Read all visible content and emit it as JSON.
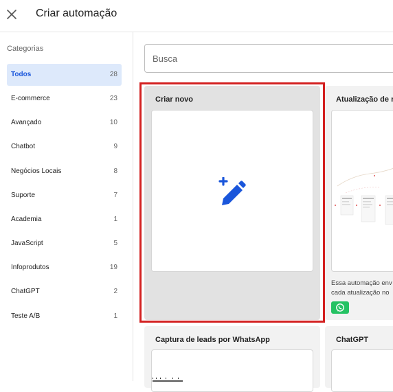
{
  "header": {
    "title": "Criar automação",
    "close_icon": "close-icon"
  },
  "sidebar": {
    "title": "Categorias",
    "items": [
      {
        "label": "Todos",
        "count": "28"
      },
      {
        "label": "E-commerce",
        "count": "23"
      },
      {
        "label": "Avançado",
        "count": "10"
      },
      {
        "label": "Chatbot",
        "count": "9"
      },
      {
        "label": "Negócios Locais",
        "count": "8"
      },
      {
        "label": "Suporte",
        "count": "7"
      },
      {
        "label": "Academia",
        "count": "1"
      },
      {
        "label": "JavaScript",
        "count": "5"
      },
      {
        "label": "Infoprodutos",
        "count": "19"
      },
      {
        "label": "ChatGPT",
        "count": "2"
      },
      {
        "label": "Teste A/B",
        "count": "1"
      }
    ]
  },
  "search": {
    "placeholder": "Busca",
    "value": ""
  },
  "cards": [
    {
      "title": "Criar novo",
      "icon": "edit-plus-icon"
    },
    {
      "title": "Atualização de r",
      "description_line1": "Essa automação env",
      "description_line2": "cada atualização no",
      "badge_icon": "whatsapp-icon"
    },
    {
      "title": "Captura de leads por WhatsApp"
    },
    {
      "title": "ChatGPT"
    }
  ],
  "colors": {
    "accent": "#1a56db",
    "active_bg": "#dde9fb",
    "highlight": "#d32020",
    "whatsapp": "#25c263"
  }
}
